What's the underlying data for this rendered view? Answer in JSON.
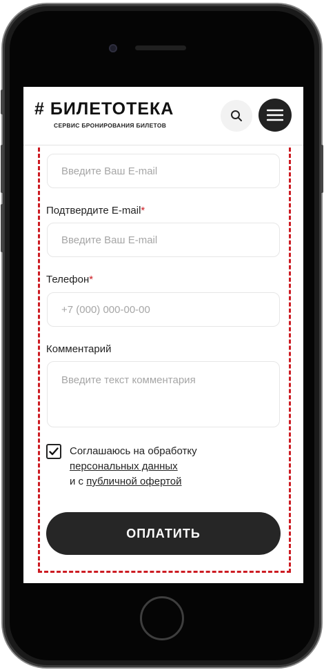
{
  "header": {
    "logo_text": "# БИЛЕТОТЕКА",
    "tagline": "СЕРВИС БРОНИРОВАНИЯ БИЛЕТОВ"
  },
  "form": {
    "email": {
      "placeholder": "Введите Ваш E-mail"
    },
    "confirm_email": {
      "label": "Подтвердите E-mail",
      "required_mark": "*",
      "placeholder": "Введите Ваш E-mail"
    },
    "phone": {
      "label": "Телефон",
      "required_mark": "*",
      "placeholder": "+7 (000) 000-00-00"
    },
    "comment": {
      "label": "Комментарий",
      "placeholder": "Введите текст комментария"
    },
    "consent": {
      "checked": true,
      "text_1": "Соглашаюсь на обработку",
      "link_1": "персональных данных",
      "text_2": "и с",
      "link_2": "публичной офертой"
    },
    "submit_label": "ОПЛАТИТЬ"
  },
  "colors": {
    "accent_red": "#cc1b22",
    "button_dark": "#262626"
  }
}
